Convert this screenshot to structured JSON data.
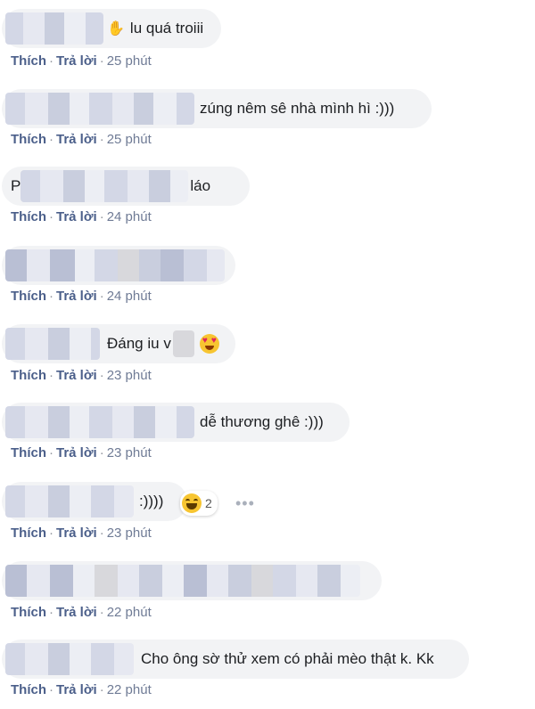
{
  "comments": [
    {
      "text": "lu quá troiii",
      "actions": {
        "like": "Thích",
        "sep": "·",
        "reply": "Trả lời",
        "time": "25 phút"
      }
    },
    {
      "text": "zúng nêm sê nhà mình hì :)))",
      "actions": {
        "like": "Thích",
        "sep": "·",
        "reply": "Trả lời",
        "time": "25 phút"
      }
    },
    {
      "prefix": "P",
      "text": "láo",
      "actions": {
        "like": "Thích",
        "sep": "·",
        "reply": "Trả lời",
        "time": "24 phút"
      }
    },
    {
      "text": "",
      "actions": {
        "like": "Thích",
        "sep": "·",
        "reply": "Trả lời",
        "time": "24 phút"
      }
    },
    {
      "text": "Đáng iu v",
      "actions": {
        "like": "Thích",
        "sep": "·",
        "reply": "Trả lời",
        "time": "23 phút"
      }
    },
    {
      "text": "dễ thương ghê :)))",
      "actions": {
        "like": "Thích",
        "sep": "·",
        "reply": "Trả lời",
        "time": "23 phút"
      }
    },
    {
      "text": ":))))",
      "reaction_count": "2",
      "actions": {
        "like": "Thích",
        "sep": "·",
        "reply": "Trả lời",
        "time": "23 phút"
      }
    },
    {
      "text": "",
      "actions": {
        "like": "Thích",
        "sep": "·",
        "reply": "Trả lời",
        "time": "22 phút"
      }
    },
    {
      "text": "Cho ông sờ thử xem có phải mèo thật k. Kk",
      "actions": {
        "like": "Thích",
        "sep": "·",
        "reply": "Trả lời",
        "time": "22 phút"
      }
    }
  ],
  "icons": {
    "wave": "waving-hand-icon",
    "heart_eyes": "heart-eyes-emoji-icon",
    "laugh": "laughing-emoji-icon",
    "more": "more-options-icon"
  },
  "more_glyph": "•••",
  "colors": {
    "bubble_bg": "#f2f3f5",
    "action_link": "#4b5f8a",
    "text": "#1c1e21"
  }
}
